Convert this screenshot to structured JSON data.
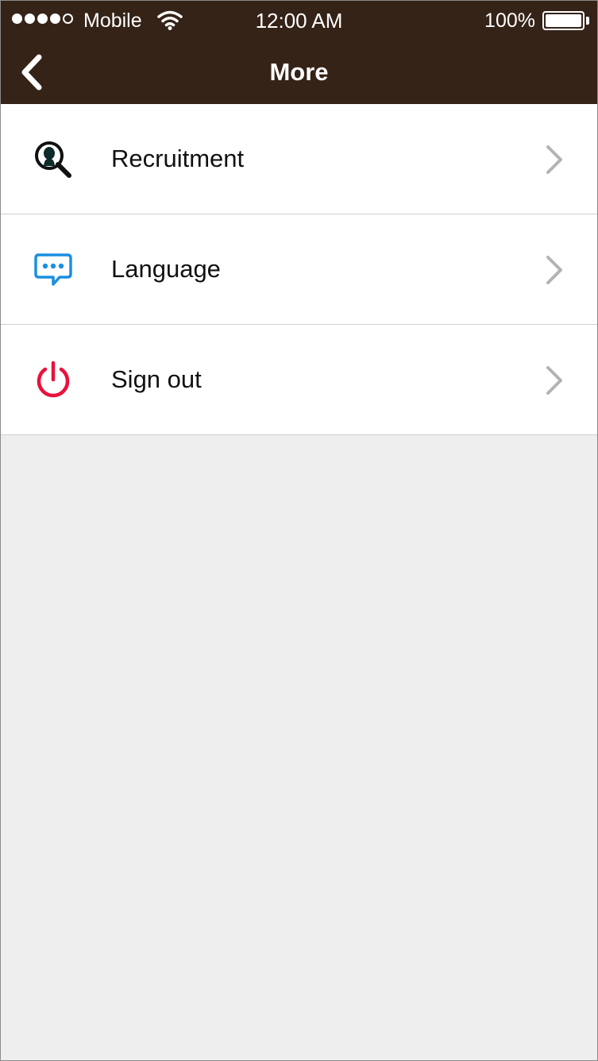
{
  "status_bar": {
    "carrier": "Mobile",
    "time": "12:00 AM",
    "battery_percent": "100%",
    "signal_icon": "signal-dots-icon",
    "wifi_icon": "wifi-icon",
    "battery_icon": "battery-icon"
  },
  "nav_bar": {
    "title": "More",
    "back_icon": "chevron-left-icon",
    "background_color": "#352318"
  },
  "menu": {
    "items": [
      {
        "label": "Recruitment",
        "icon": "recruitment-search-icon",
        "icon_color": "#111111"
      },
      {
        "label": "Language",
        "icon": "chat-bubble-icon",
        "icon_color": "#1a8fe0"
      },
      {
        "label": "Sign out",
        "icon": "power-icon",
        "icon_color": "#e8123c"
      }
    ],
    "chevron_icon": "chevron-right-icon",
    "chevron_color": "#b3b3b3"
  }
}
